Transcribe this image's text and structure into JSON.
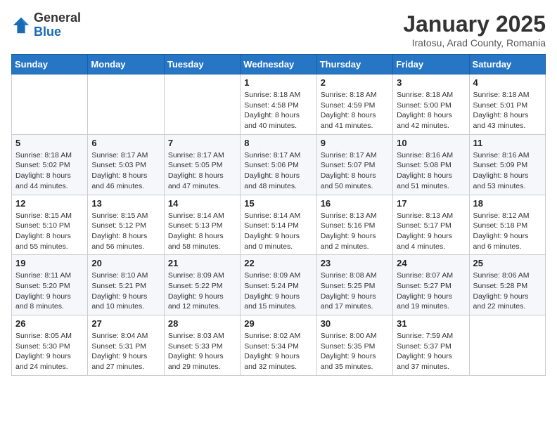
{
  "header": {
    "logo_general": "General",
    "logo_blue": "Blue",
    "title": "January 2025",
    "subtitle": "Iratosu, Arad County, Romania"
  },
  "weekdays": [
    "Sunday",
    "Monday",
    "Tuesday",
    "Wednesday",
    "Thursday",
    "Friday",
    "Saturday"
  ],
  "weeks": [
    [
      {
        "day": "",
        "info": ""
      },
      {
        "day": "",
        "info": ""
      },
      {
        "day": "",
        "info": ""
      },
      {
        "day": "1",
        "info": "Sunrise: 8:18 AM\nSunset: 4:58 PM\nDaylight: 8 hours\nand 40 minutes."
      },
      {
        "day": "2",
        "info": "Sunrise: 8:18 AM\nSunset: 4:59 PM\nDaylight: 8 hours\nand 41 minutes."
      },
      {
        "day": "3",
        "info": "Sunrise: 8:18 AM\nSunset: 5:00 PM\nDaylight: 8 hours\nand 42 minutes."
      },
      {
        "day": "4",
        "info": "Sunrise: 8:18 AM\nSunset: 5:01 PM\nDaylight: 8 hours\nand 43 minutes."
      }
    ],
    [
      {
        "day": "5",
        "info": "Sunrise: 8:18 AM\nSunset: 5:02 PM\nDaylight: 8 hours\nand 44 minutes."
      },
      {
        "day": "6",
        "info": "Sunrise: 8:17 AM\nSunset: 5:03 PM\nDaylight: 8 hours\nand 46 minutes."
      },
      {
        "day": "7",
        "info": "Sunrise: 8:17 AM\nSunset: 5:05 PM\nDaylight: 8 hours\nand 47 minutes."
      },
      {
        "day": "8",
        "info": "Sunrise: 8:17 AM\nSunset: 5:06 PM\nDaylight: 8 hours\nand 48 minutes."
      },
      {
        "day": "9",
        "info": "Sunrise: 8:17 AM\nSunset: 5:07 PM\nDaylight: 8 hours\nand 50 minutes."
      },
      {
        "day": "10",
        "info": "Sunrise: 8:16 AM\nSunset: 5:08 PM\nDaylight: 8 hours\nand 51 minutes."
      },
      {
        "day": "11",
        "info": "Sunrise: 8:16 AM\nSunset: 5:09 PM\nDaylight: 8 hours\nand 53 minutes."
      }
    ],
    [
      {
        "day": "12",
        "info": "Sunrise: 8:15 AM\nSunset: 5:10 PM\nDaylight: 8 hours\nand 55 minutes."
      },
      {
        "day": "13",
        "info": "Sunrise: 8:15 AM\nSunset: 5:12 PM\nDaylight: 8 hours\nand 56 minutes."
      },
      {
        "day": "14",
        "info": "Sunrise: 8:14 AM\nSunset: 5:13 PM\nDaylight: 8 hours\nand 58 minutes."
      },
      {
        "day": "15",
        "info": "Sunrise: 8:14 AM\nSunset: 5:14 PM\nDaylight: 9 hours\nand 0 minutes."
      },
      {
        "day": "16",
        "info": "Sunrise: 8:13 AM\nSunset: 5:16 PM\nDaylight: 9 hours\nand 2 minutes."
      },
      {
        "day": "17",
        "info": "Sunrise: 8:13 AM\nSunset: 5:17 PM\nDaylight: 9 hours\nand 4 minutes."
      },
      {
        "day": "18",
        "info": "Sunrise: 8:12 AM\nSunset: 5:18 PM\nDaylight: 9 hours\nand 6 minutes."
      }
    ],
    [
      {
        "day": "19",
        "info": "Sunrise: 8:11 AM\nSunset: 5:20 PM\nDaylight: 9 hours\nand 8 minutes."
      },
      {
        "day": "20",
        "info": "Sunrise: 8:10 AM\nSunset: 5:21 PM\nDaylight: 9 hours\nand 10 minutes."
      },
      {
        "day": "21",
        "info": "Sunrise: 8:09 AM\nSunset: 5:22 PM\nDaylight: 9 hours\nand 12 minutes."
      },
      {
        "day": "22",
        "info": "Sunrise: 8:09 AM\nSunset: 5:24 PM\nDaylight: 9 hours\nand 15 minutes."
      },
      {
        "day": "23",
        "info": "Sunrise: 8:08 AM\nSunset: 5:25 PM\nDaylight: 9 hours\nand 17 minutes."
      },
      {
        "day": "24",
        "info": "Sunrise: 8:07 AM\nSunset: 5:27 PM\nDaylight: 9 hours\nand 19 minutes."
      },
      {
        "day": "25",
        "info": "Sunrise: 8:06 AM\nSunset: 5:28 PM\nDaylight: 9 hours\nand 22 minutes."
      }
    ],
    [
      {
        "day": "26",
        "info": "Sunrise: 8:05 AM\nSunset: 5:30 PM\nDaylight: 9 hours\nand 24 minutes."
      },
      {
        "day": "27",
        "info": "Sunrise: 8:04 AM\nSunset: 5:31 PM\nDaylight: 9 hours\nand 27 minutes."
      },
      {
        "day": "28",
        "info": "Sunrise: 8:03 AM\nSunset: 5:33 PM\nDaylight: 9 hours\nand 29 minutes."
      },
      {
        "day": "29",
        "info": "Sunrise: 8:02 AM\nSunset: 5:34 PM\nDaylight: 9 hours\nand 32 minutes."
      },
      {
        "day": "30",
        "info": "Sunrise: 8:00 AM\nSunset: 5:35 PM\nDaylight: 9 hours\nand 35 minutes."
      },
      {
        "day": "31",
        "info": "Sunrise: 7:59 AM\nSunset: 5:37 PM\nDaylight: 9 hours\nand 37 minutes."
      },
      {
        "day": "",
        "info": ""
      }
    ]
  ]
}
